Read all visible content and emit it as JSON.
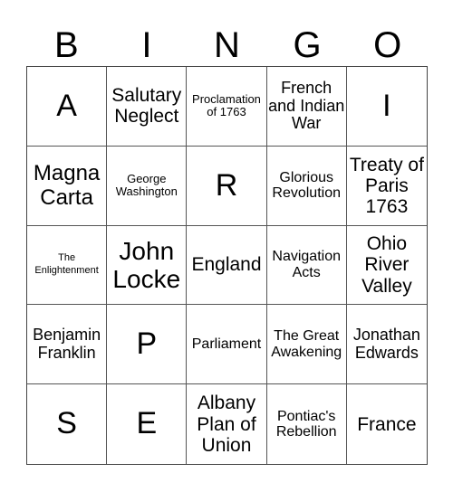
{
  "header": [
    "B",
    "I",
    "N",
    "G",
    "O"
  ],
  "cells": [
    "A",
    "Salutary Neglect",
    "Proclamation of 1763",
    "French and Indian War",
    "I",
    "Magna Carta",
    "George Washington",
    "R",
    "Glorious Revolution",
    "Treaty of Paris 1763",
    "The Enlightenment",
    "John Locke",
    "England",
    "Navigation Acts",
    "Ohio River Valley",
    "Benjamin Franklin",
    "P",
    "Parliament",
    "The Great Awakening",
    "Jonathan Edwards",
    "S",
    "E",
    "Albany Plan of Union",
    "Pontiac's Rebellion",
    "France"
  ]
}
